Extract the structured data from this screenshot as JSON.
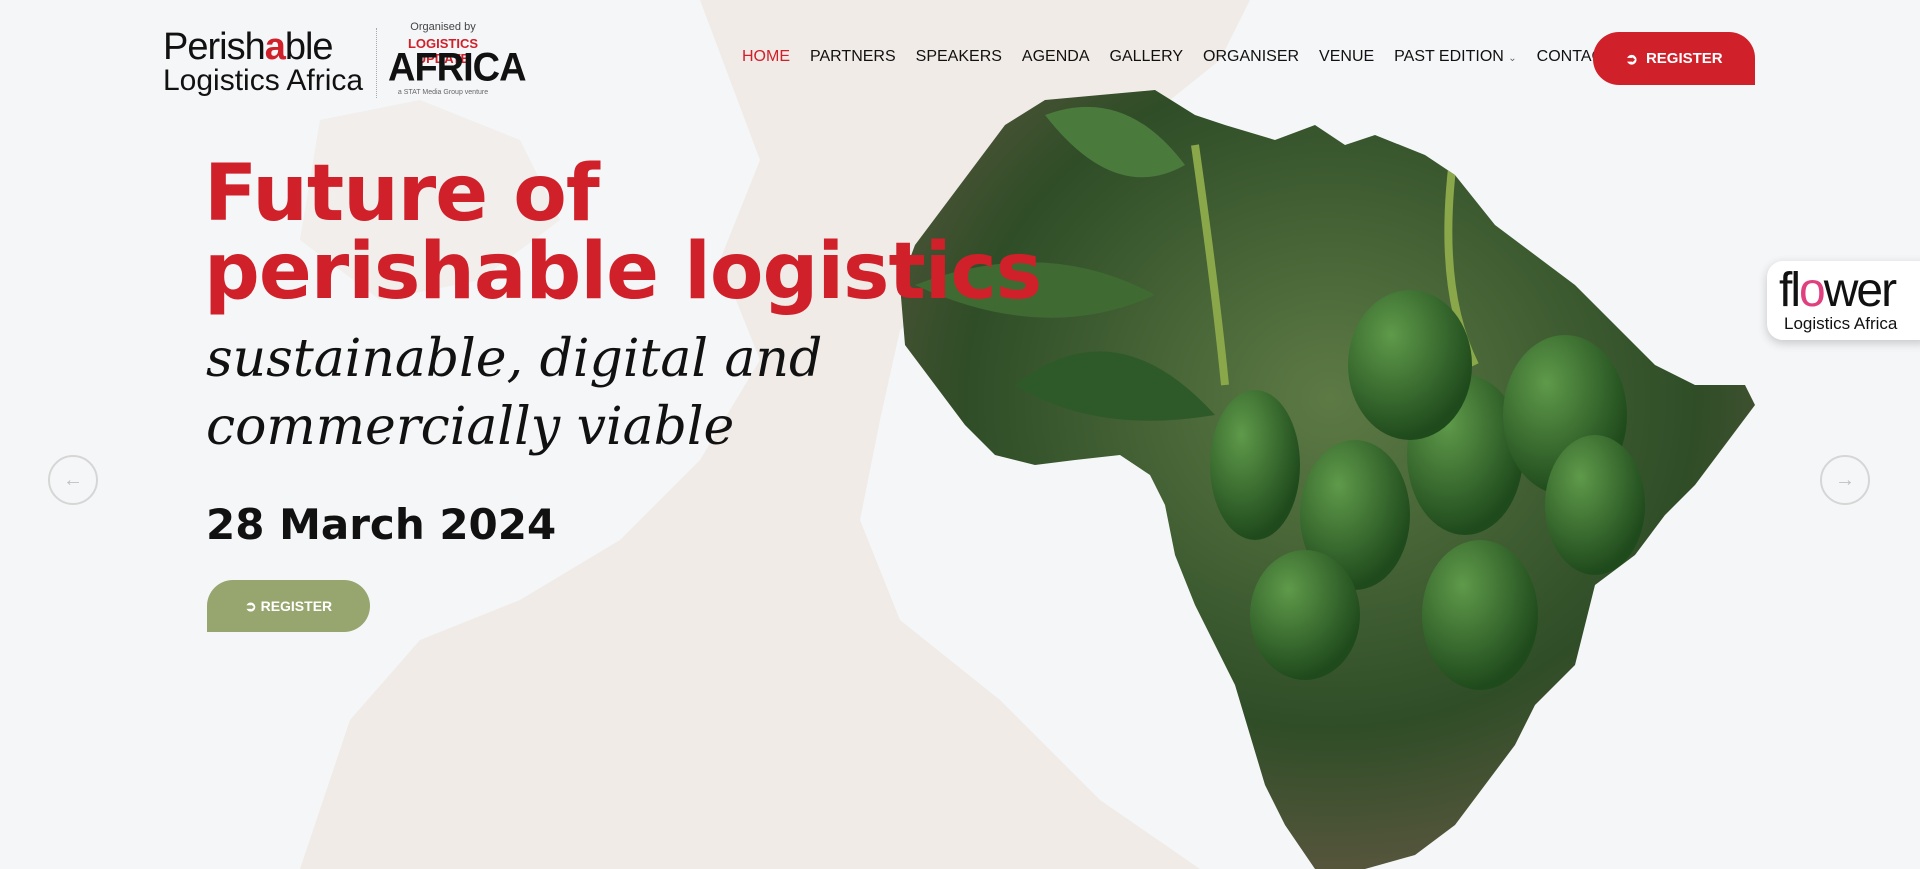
{
  "logo": {
    "line1_a": "Perish",
    "line1_b": "a",
    "line1_c": "ble",
    "line2": "Logistics Africa",
    "organised_by": "Organised by",
    "org_line1": "LOGISTICS UPDATE",
    "org_line2": "AFRICA",
    "org_tagline": "a STAT Media Group venture"
  },
  "nav": {
    "items": [
      {
        "label": "HOME"
      },
      {
        "label": "PARTNERS"
      },
      {
        "label": "SPEAKERS"
      },
      {
        "label": "AGENDA"
      },
      {
        "label": "GALLERY"
      },
      {
        "label": "ORGANISER"
      },
      {
        "label": "VENUE"
      },
      {
        "label": "PAST EDITION"
      },
      {
        "label": "CONTACT"
      }
    ],
    "active": "HOME",
    "dropdown_icon": "chevron-down-icon"
  },
  "header": {
    "register_label": "REGISTER"
  },
  "hero": {
    "title_line1": "Future of",
    "title_line2": "perishable logistics",
    "subtitle_line1": "sustainable, digital and",
    "subtitle_line2": "commercially viable",
    "date": "28 March 2024",
    "register_label": "REGISTER",
    "prev_icon": "arrow-left-icon",
    "next_icon": "arrow-right-icon"
  },
  "badge": {
    "word_a": "fl",
    "word_o": "o",
    "word_b": "wer",
    "line2": "Logistics Africa"
  },
  "colors": {
    "brand_red": "#d0202a",
    "button_green": "#97a56e"
  }
}
